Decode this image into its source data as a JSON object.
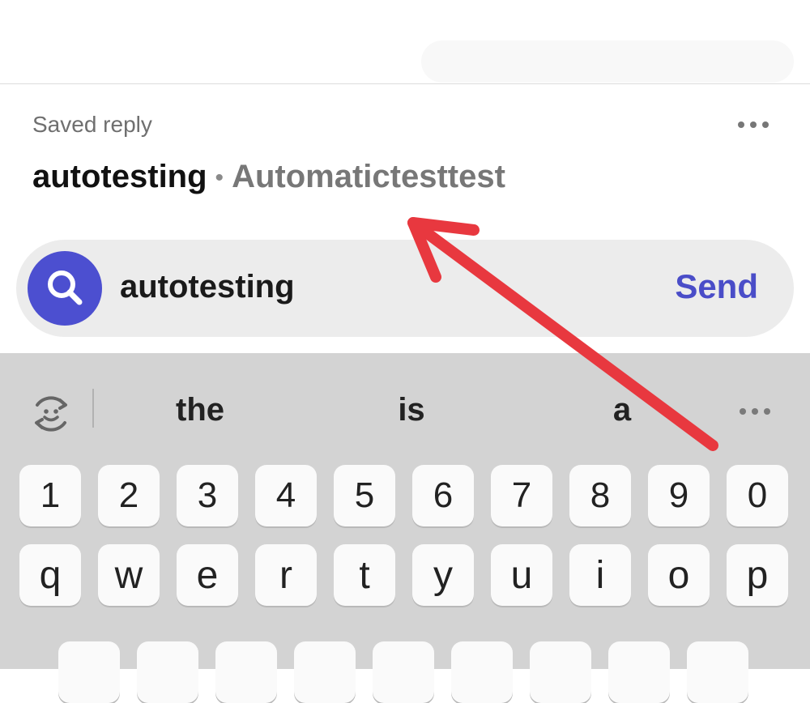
{
  "saved_reply": {
    "label": "Saved reply",
    "name": "autotesting",
    "separator": "•",
    "text": "Automatictesttest"
  },
  "search": {
    "value": "autotesting",
    "send_label": "Send",
    "accent_color": "#4c4fd0"
  },
  "keyboard": {
    "suggestions": [
      "the",
      "is",
      "a"
    ],
    "number_row": [
      "1",
      "2",
      "3",
      "4",
      "5",
      "6",
      "7",
      "8",
      "9",
      "0"
    ],
    "letter_row_1": [
      "q",
      "w",
      "e",
      "r",
      "t",
      "y",
      "u",
      "i",
      "o",
      "p"
    ]
  },
  "annotation": {
    "arrow_color": "#e8383f"
  },
  "icons": {
    "more_options": "more-horizontal-icon",
    "search": "search-icon",
    "rotate": "rotate-emoji-icon"
  }
}
